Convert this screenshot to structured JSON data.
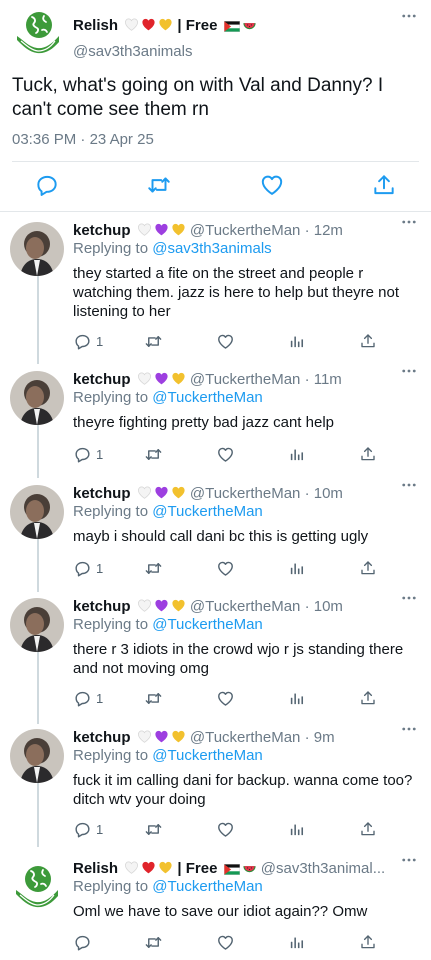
{
  "main_tweet": {
    "display_name": "Relish",
    "name_suffix": "| Free",
    "handle": "@sav3th3animals",
    "text": "Tuck, what's going on with Val and Danny? I can't come see them rn",
    "time": "03:36 PM",
    "date_separator": "·",
    "date": "23 Apr 25",
    "actions": [
      "reply-icon",
      "retweet-icon",
      "like-icon",
      "share-icon"
    ]
  },
  "replies": [
    {
      "display_name": "ketchup",
      "handle": "@TuckertheMan",
      "age": "· 12m",
      "replying_label": "Replying to",
      "replying_to": "@sav3th3animals",
      "text": "they started a fite on the street and people r watching them. jazz is here to help but theyre not listening to her",
      "reply_count": "1"
    },
    {
      "display_name": "ketchup",
      "handle": "@TuckertheMan",
      "age": "· 11m",
      "replying_label": "Replying to",
      "replying_to": "@TuckertheMan",
      "text": "theyre fighting pretty bad jazz cant help",
      "reply_count": "1"
    },
    {
      "display_name": "ketchup",
      "handle": "@TuckertheMan",
      "age": "· 10m",
      "replying_label": "Replying to",
      "replying_to": "@TuckertheMan",
      "text": "mayb i should call dani bc this is getting ugly",
      "reply_count": "1"
    },
    {
      "display_name": "ketchup",
      "handle": "@TuckertheMan",
      "age": "· 10m",
      "replying_label": "Replying to",
      "replying_to": "@TuckertheMan",
      "text": "there r 3 idiots in the crowd wjo r js standing there and not moving omg",
      "reply_count": "1"
    },
    {
      "display_name": "ketchup",
      "handle": "@TuckertheMan",
      "age": "· 9m",
      "replying_label": "Replying to",
      "replying_to": "@TuckertheMan",
      "text": "fuck it im calling dani for backup. wanna come too? ditch wtv your doing",
      "reply_count": "1"
    },
    {
      "display_name": "Relish",
      "name_suffix": "| Free",
      "handle": "@sav3th3animal...",
      "age": "",
      "replying_label": "Replying to",
      "replying_to": "@TuckertheMan",
      "text": "Oml we have to save our idiot again?? Omw",
      "reply_count": ""
    }
  ],
  "colors": {
    "link": "#1d9bf0",
    "secondary_text": "#6b7a87",
    "icon": "#536471",
    "main_action_icon": "#1d9bf0",
    "divider": "#e3e7ea",
    "thread_line": "#cfd9de",
    "relish_green": "#3d9a3a"
  },
  "icons": {
    "more": "more-dots-icon",
    "reply": "reply-icon",
    "retweet": "retweet-icon",
    "like": "like-icon",
    "views": "views-icon",
    "share": "share-icon",
    "name_emoji_relish": [
      "white-heart-emoji",
      "red-heart-emoji",
      "yellow-heart-emoji",
      "palestine-flag-emoji",
      "watermelon-emoji"
    ],
    "name_emoji_ketchup": [
      "white-heart-emoji",
      "purple-heart-emoji",
      "yellow-heart-emoji"
    ]
  }
}
